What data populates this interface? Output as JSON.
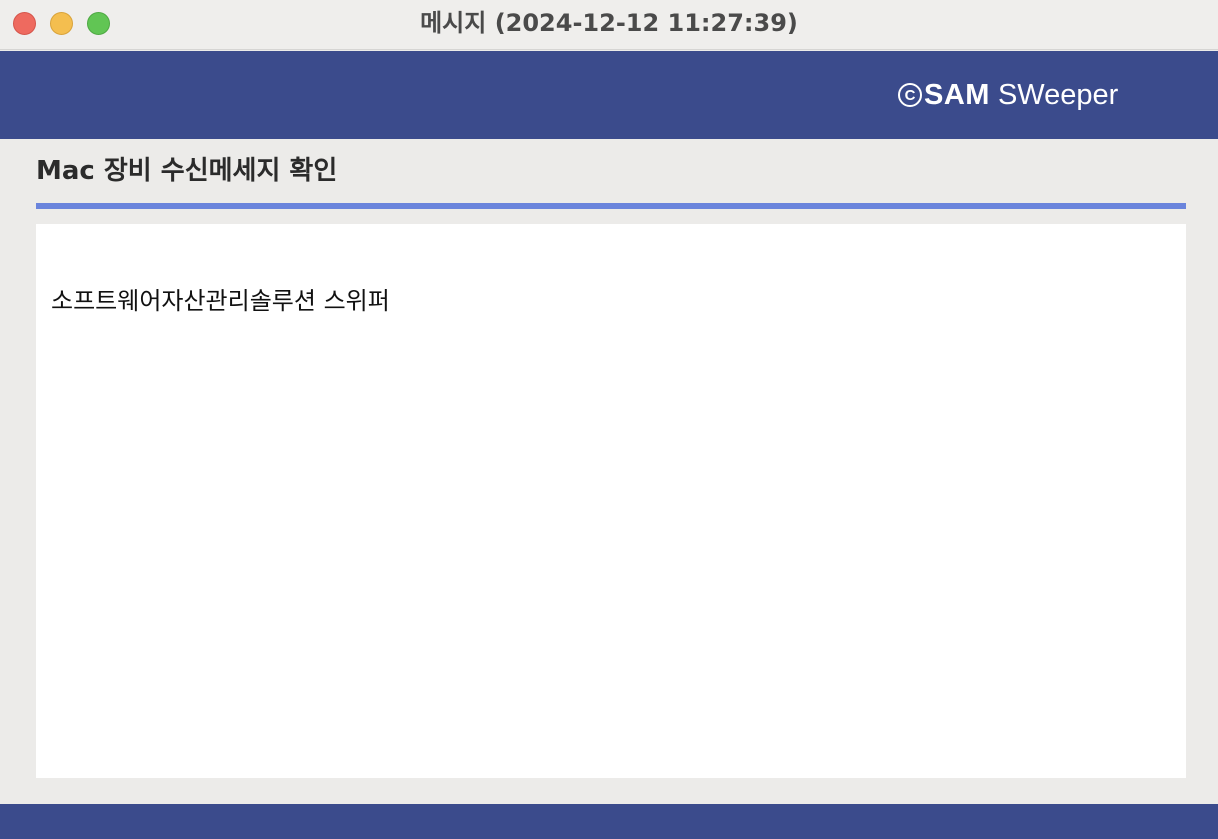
{
  "window": {
    "title": "메시지 (2024-12-12 11:27:39)"
  },
  "header": {
    "brand_symbol": "C",
    "brand_sam": "SAM",
    "brand_sweeper": "SWeeper"
  },
  "main": {
    "heading": "Mac 장비 수신메세지 확인",
    "message": "소프트웨어자산관리솔루션 스위퍼"
  },
  "colors": {
    "header_band": "#3b4b8c",
    "accent_rule": "#6a84dc",
    "background": "#ecebe9",
    "panel": "#ffffff"
  }
}
